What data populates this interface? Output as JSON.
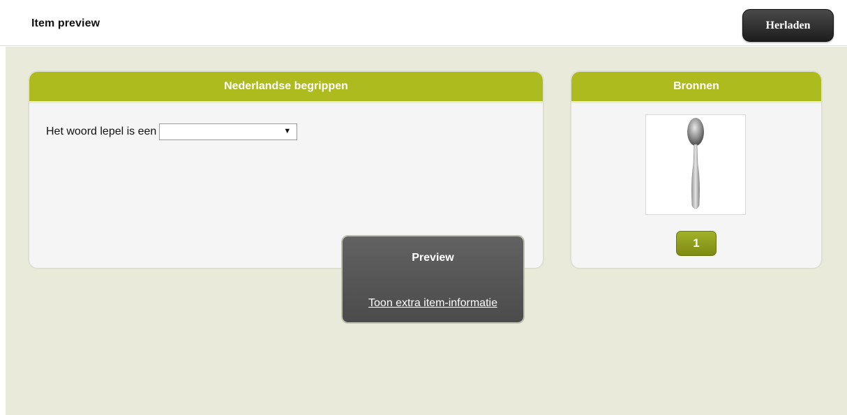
{
  "header": {
    "title": "Item preview",
    "reload_label": "Herladen"
  },
  "left_panel": {
    "title": "Nederlandse begrippen",
    "question_text": "Het woord lepel is een",
    "select_value": ""
  },
  "right_panel": {
    "title": "Bronnen",
    "image_icon": "spoon-image",
    "source_number": "1"
  },
  "preview_popup": {
    "title": "Preview",
    "link_label": "Toon extra item-informatie"
  },
  "colors": {
    "accent": "#aebb1f",
    "background": "#eaeadb",
    "dark_button": "#2b2b2b"
  }
}
